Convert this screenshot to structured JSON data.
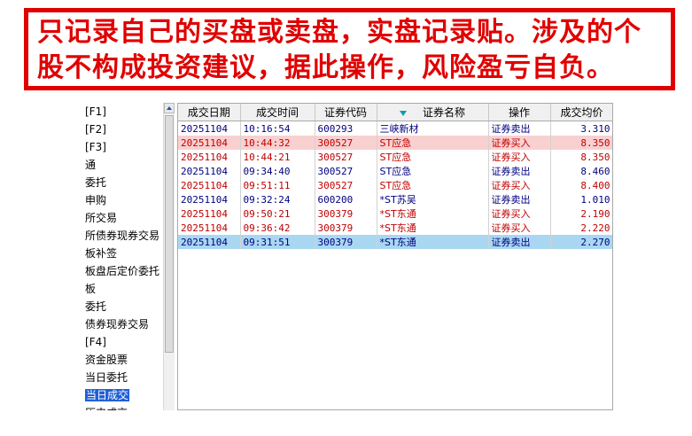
{
  "banner": {
    "line1": "只记录自己的买盘或卖盘，实盘记录贴。涉及的个",
    "line2": "股不构成投资建议，据此操作，风险盈亏自负。"
  },
  "menu": {
    "items": [
      "[F1]",
      "[F2]",
      "[F3]",
      "通",
      "委托",
      "申购",
      "所交易",
      "所债券现券交易",
      "板补签",
      "板盘后定价委托",
      "板",
      "委托",
      "债券现券交易",
      "[F4]",
      "资金股票",
      "当日委托",
      "当日成交",
      "历史成交"
    ],
    "selected_index": 16
  },
  "table": {
    "columns": [
      "成交日期",
      "成交时间",
      "证券代码",
      "证券名称",
      "操作",
      "成交均价"
    ],
    "rows": [
      {
        "date": "20251104",
        "time": "10:16:54",
        "code": "600293",
        "name": "三峡新材",
        "op": "证券卖出",
        "price": "3.310",
        "side": "sell",
        "state": "normal"
      },
      {
        "date": "20251104",
        "time": "10:44:32",
        "code": "300527",
        "name": "ST应急",
        "op": "证券买入",
        "price": "8.350",
        "side": "buy",
        "state": "highlight"
      },
      {
        "date": "20251104",
        "time": "10:44:21",
        "code": "300527",
        "name": "ST应急",
        "op": "证券买入",
        "price": "8.350",
        "side": "buy",
        "state": "normal"
      },
      {
        "date": "20251104",
        "time": "09:34:40",
        "code": "300527",
        "name": "ST应急",
        "op": "证券卖出",
        "price": "8.460",
        "side": "sell",
        "state": "normal"
      },
      {
        "date": "20251104",
        "time": "09:51:11",
        "code": "300527",
        "name": "ST应急",
        "op": "证券买入",
        "price": "8.400",
        "side": "buy",
        "state": "normal"
      },
      {
        "date": "20251104",
        "time": "09:32:24",
        "code": "600200",
        "name": "*ST苏吴",
        "op": "证券卖出",
        "price": "1.010",
        "side": "sell",
        "state": "normal"
      },
      {
        "date": "20251104",
        "time": "09:50:21",
        "code": "300379",
        "name": "*ST东通",
        "op": "证券买入",
        "price": "2.190",
        "side": "buy",
        "state": "normal"
      },
      {
        "date": "20251104",
        "time": "09:36:42",
        "code": "300379",
        "name": "*ST东通",
        "op": "证券买入",
        "price": "2.220",
        "side": "buy",
        "state": "normal"
      },
      {
        "date": "20251104",
        "time": "09:31:51",
        "code": "300379",
        "name": "*ST东通",
        "op": "证券卖出",
        "price": "2.270",
        "side": "sell",
        "state": "selected"
      }
    ]
  },
  "colors": {
    "banner_red": "#e00000",
    "buy": "#c00000",
    "sell": "#00007f",
    "selected_row": "#a9d7f2",
    "highlight_row": "#f9d0d0"
  },
  "icons": {
    "scroll_up": "triangle-up-icon",
    "filter": "filter-triangle-icon"
  }
}
